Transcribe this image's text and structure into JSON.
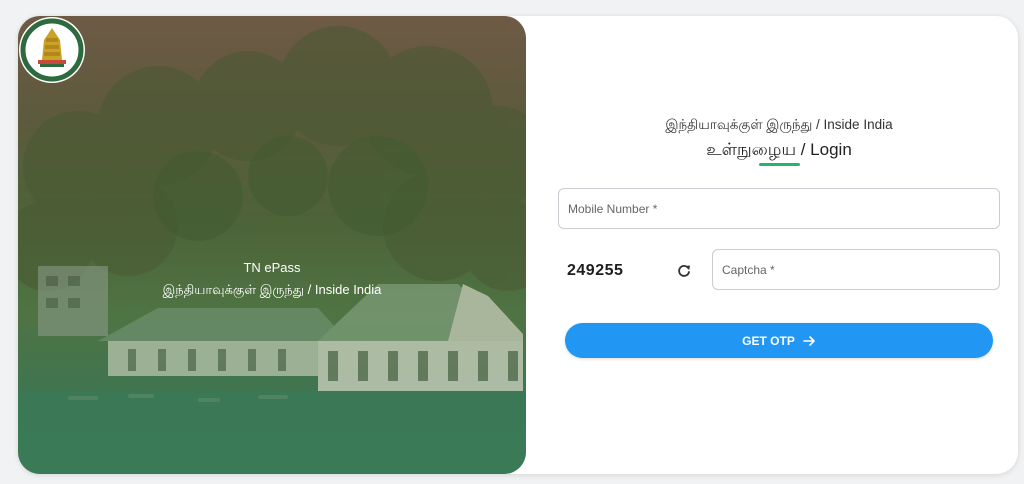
{
  "hero": {
    "title": "TN ePass",
    "subtitle": "இந்தியாவுக்குள் இருந்து / Inside India"
  },
  "login": {
    "subheading": "இந்தியாவுக்குள் இருந்து / Inside India",
    "heading": "உள்நுழைய / Login",
    "accent_color": "#27b36b"
  },
  "form": {
    "mobile_placeholder": "Mobile Number *",
    "captcha_code": "249255",
    "captcha_placeholder": "Captcha *",
    "submit_label": "GET OTP",
    "button_color": "#2196f3"
  }
}
